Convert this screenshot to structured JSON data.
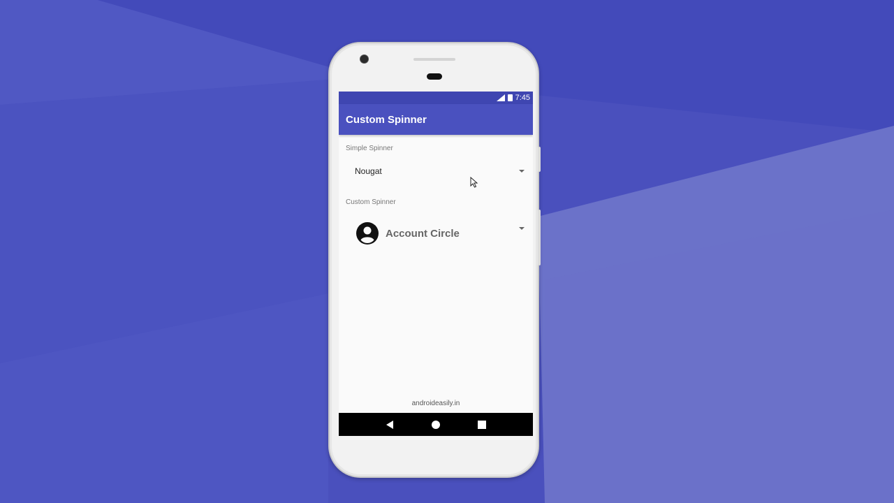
{
  "status_bar": {
    "time": "7:45"
  },
  "app_bar": {
    "title": "Custom Spinner"
  },
  "simple_spinner": {
    "label": "Simple Spinner",
    "selected": "Nougat"
  },
  "custom_spinner": {
    "label": "Custom Spinner",
    "selected": "Account Circle",
    "icon": "account-circle-icon"
  },
  "footer": {
    "watermark": "androideasily.in"
  },
  "nav": {
    "back": "back-icon",
    "home": "home-icon",
    "recents": "recents-icon"
  },
  "colors": {
    "primary": "#4a51bf",
    "primary_dark": "#3f46b1",
    "background": "#4a4fbd",
    "screen": "#fafafa"
  }
}
